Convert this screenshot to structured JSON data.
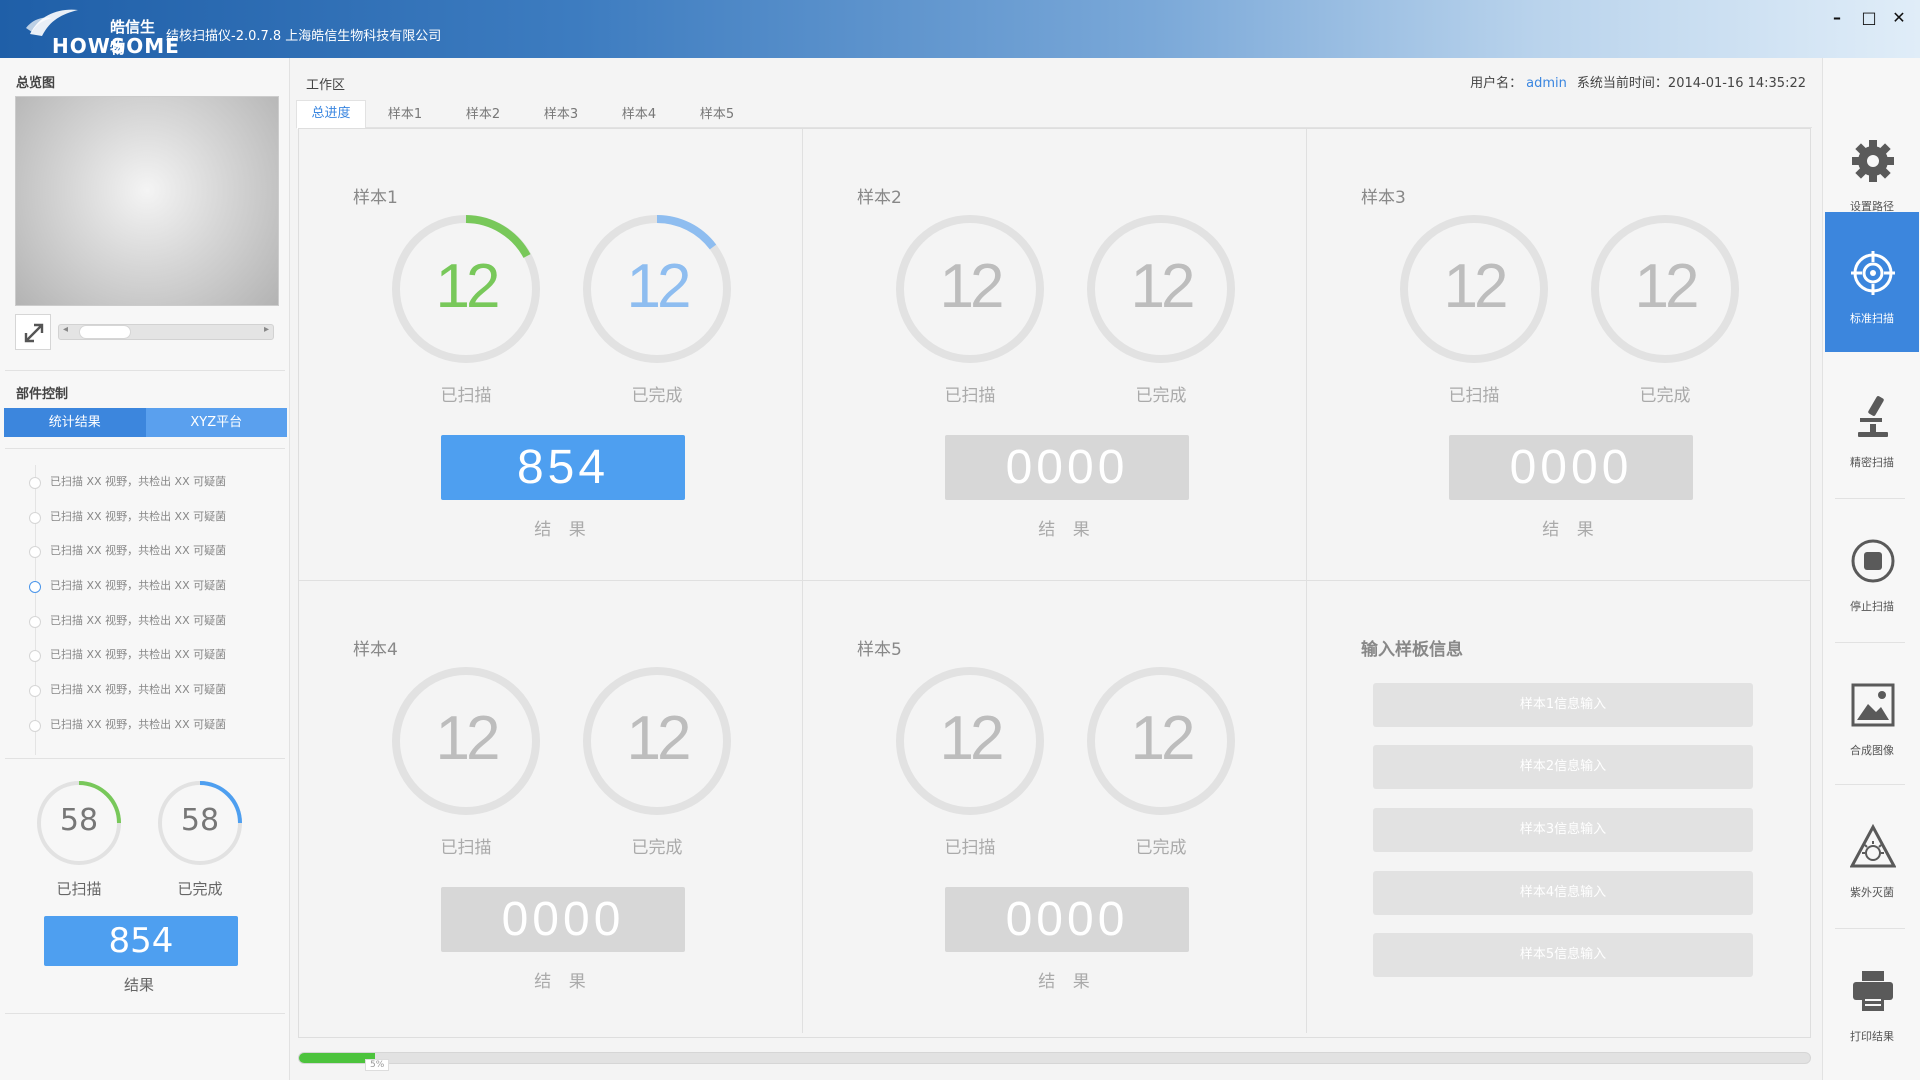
{
  "app": {
    "logo_cn": "皓信生物",
    "logo_en": "HOWSOME",
    "title": "结核扫描仪-2.0.7.8   上海皓信生物科技有限公司"
  },
  "window": {
    "minimize": "–",
    "maximize": "□",
    "close": "✕"
  },
  "left": {
    "overview_title": "总览图",
    "component_title": "部件控制",
    "tabs": [
      "统计结果",
      "XYZ平台"
    ],
    "log_items": [
      "已扫描 XX 视野，共检出 XX 可疑菌",
      "已扫描 XX 视野，共检出 XX 可疑菌",
      "已扫描 XX 视野，共检出 XX 可疑菌",
      "已扫描 XX 视野，共检出 XX 可疑菌",
      "已扫描 XX 视野，共检出 XX 可疑菌",
      "已扫描 XX 视野，共检出 XX 可疑菌",
      "已扫描 XX 视野，共检出 XX 可疑菌",
      "已扫描 XX 视野，共检出 XX 可疑菌"
    ],
    "scanned_value": "58",
    "completed_value": "58",
    "scanned_label": "已扫描",
    "completed_label": "已完成",
    "result_value": "854",
    "result_label": "结果"
  },
  "work": {
    "title": "工作区",
    "user_label": "用户名：",
    "user": "admin",
    "time_label": "系统当前时间：",
    "time": "2014-01-16 14:35:22",
    "tabs": [
      "总进度",
      "样本1",
      "样本2",
      "样本3",
      "样本4",
      "样本5"
    ],
    "samples": [
      {
        "title": "样本1",
        "scanned": "12",
        "completed": "12",
        "scanned_label": "已扫描",
        "completed_label": "已完成",
        "result": "854",
        "result_label": "结 果"
      },
      {
        "title": "样本2",
        "scanned": "12",
        "completed": "12",
        "scanned_label": "已扫描",
        "completed_label": "已完成",
        "result": "0000",
        "result_label": "结 果"
      },
      {
        "title": "样本3",
        "scanned": "12",
        "completed": "12",
        "scanned_label": "已扫描",
        "completed_label": "已完成",
        "result": "0000",
        "result_label": "结 果"
      },
      {
        "title": "样本4",
        "scanned": "12",
        "completed": "12",
        "scanned_label": "已扫描",
        "completed_label": "已完成",
        "result": "0000",
        "result_label": "结 果"
      },
      {
        "title": "样本5",
        "scanned": "12",
        "completed": "12",
        "scanned_label": "已扫描",
        "completed_label": "已完成",
        "result": "0000",
        "result_label": "结 果"
      }
    ],
    "info_title": "输入样板信息",
    "info_buttons": [
      "样本1信息输入",
      "样本2信息输入",
      "样本3信息输入",
      "样本4信息输入",
      "样本5信息输入"
    ],
    "progress_text": "5%",
    "progress_fraction": 0.05
  },
  "tools": [
    {
      "label": "设置路径",
      "icon": "gear-icon"
    },
    {
      "label": "标准扫描",
      "icon": "target-icon"
    },
    {
      "label": "精密扫描",
      "icon": "microscope-icon"
    },
    {
      "label": "停止扫描",
      "icon": "stop-icon"
    },
    {
      "label": "合成图像",
      "icon": "image-icon"
    },
    {
      "label": "紫外灭菌",
      "icon": "uv-icon"
    },
    {
      "label": "打印结果",
      "icon": "printer-icon"
    }
  ],
  "colors": {
    "green": "#78c85a",
    "blue": "#4e9ff0",
    "ring_bg": "#e2e2e2",
    "accent": "#3c86dd"
  }
}
